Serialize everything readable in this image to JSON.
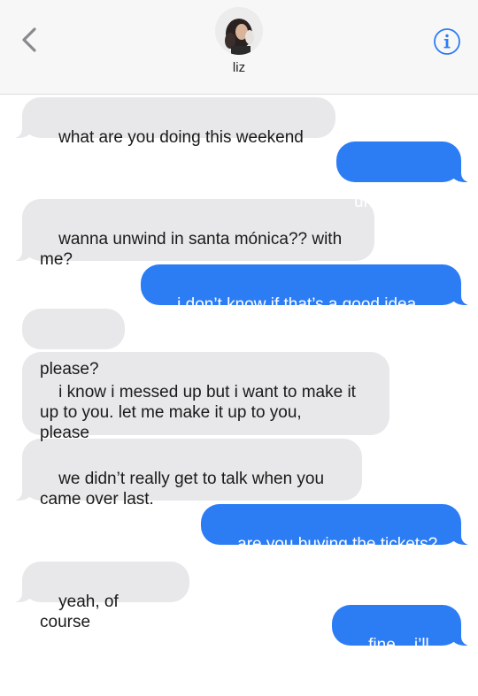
{
  "header": {
    "contact_name": "liz",
    "back_icon": "chevron-left-icon",
    "info_icon": "info-icon",
    "accent_color": "#2c7df4"
  },
  "messages": [
    {
      "sender": "contact",
      "text": "what are you doing this weekend"
    },
    {
      "sender": "me",
      "text": "unwinding"
    },
    {
      "sender": "contact",
      "text": "wanna unwind in santa mónica?? with\nme?"
    },
    {
      "sender": "me",
      "text": "i don’t know if that’s a good idea..."
    },
    {
      "sender": "contact",
      "text": "please?"
    },
    {
      "sender": "contact",
      "text": "i know i messed up but i want to make it\nup to you. let me make it up to you,\nplease"
    },
    {
      "sender": "contact",
      "text": "we didn’t really get to talk when you\ncame over last."
    },
    {
      "sender": "me",
      "text": "are you buying the tickets?"
    },
    {
      "sender": "contact",
      "text": "yeah, of course"
    },
    {
      "sender": "me",
      "text": "fine... i’ll go"
    }
  ]
}
